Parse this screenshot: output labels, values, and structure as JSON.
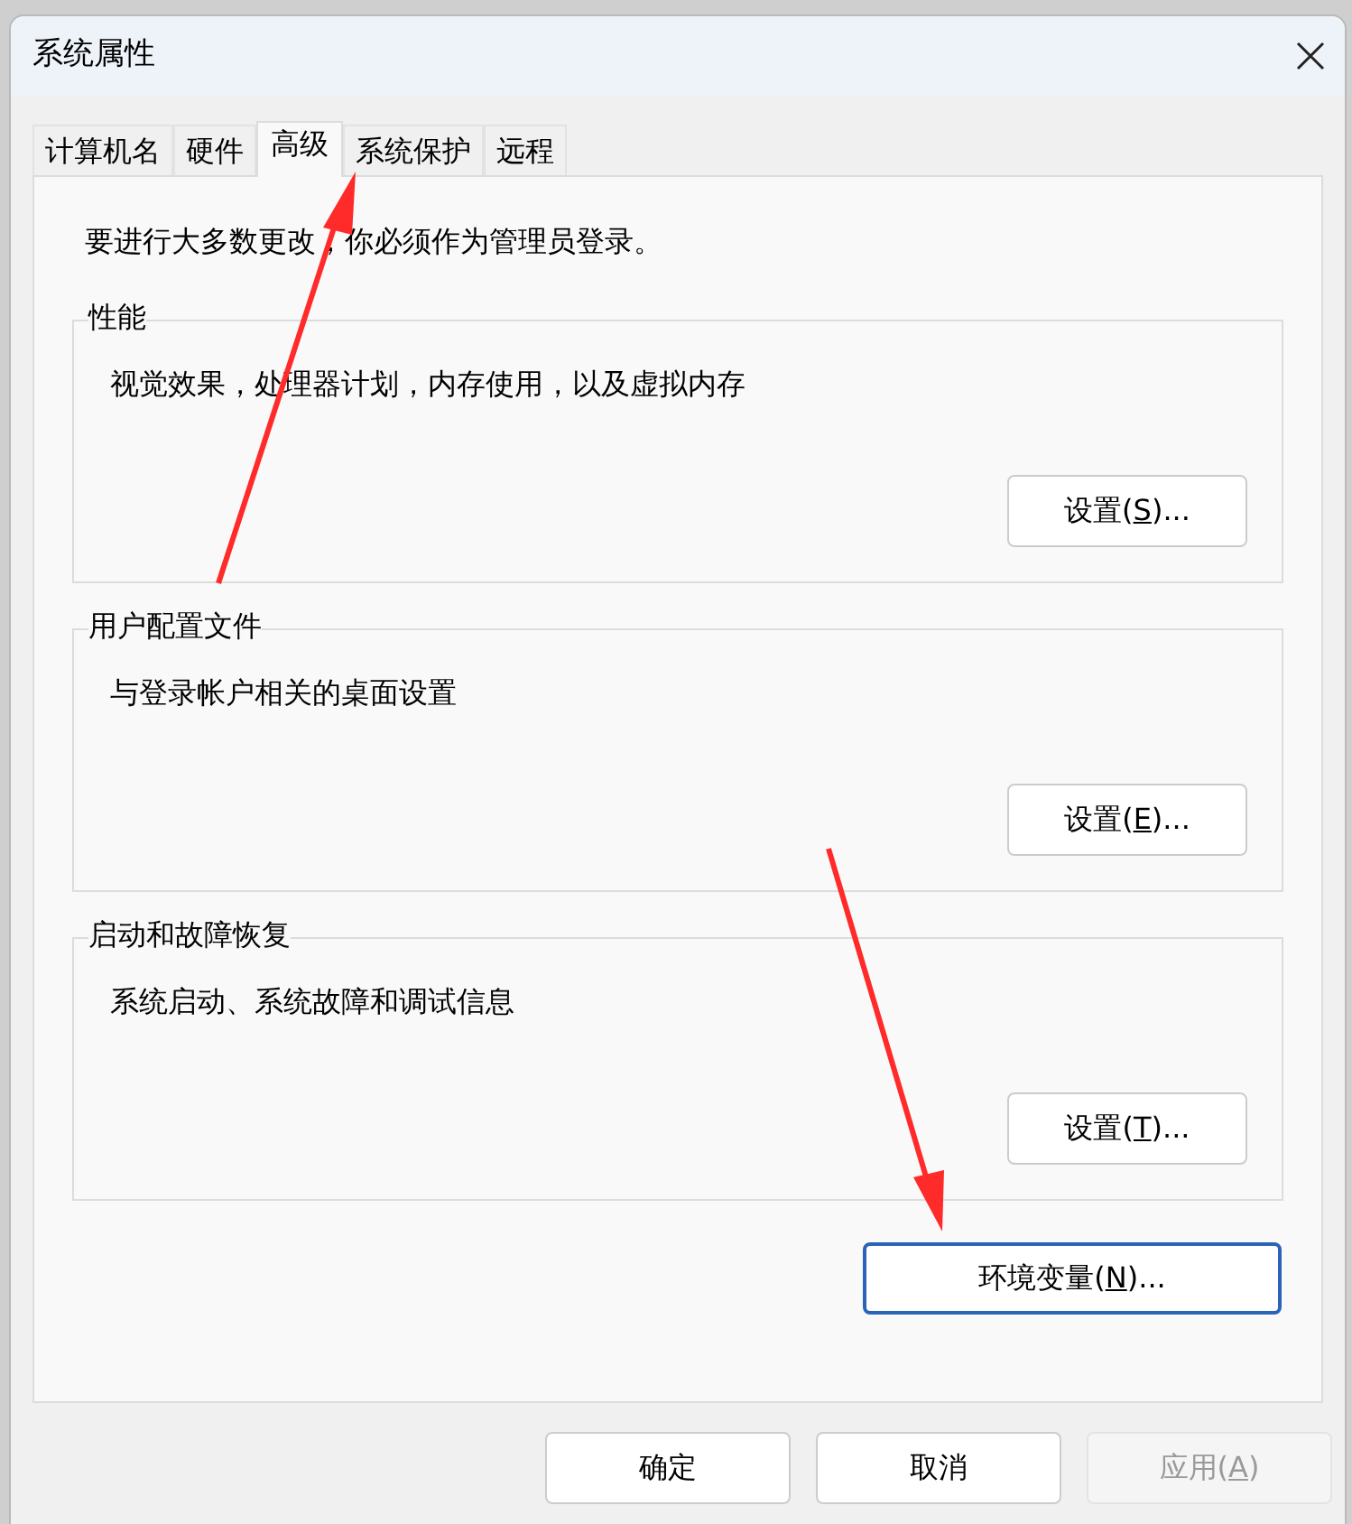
{
  "window": {
    "title": "系统属性"
  },
  "tabs": [
    {
      "label": "计算机名",
      "selected": false
    },
    {
      "label": "硬件",
      "selected": false
    },
    {
      "label": "高级",
      "selected": true
    },
    {
      "label": "系统保护",
      "selected": false
    },
    {
      "label": "远程",
      "selected": false
    }
  ],
  "notice": "要进行大多数更改，你必须作为管理员登录。",
  "groups": [
    {
      "title": "性能",
      "description": "视觉效果，处理器计划，内存使用，以及虚拟内存",
      "button": {
        "before": "设置(",
        "key": "S",
        "after": ")..."
      }
    },
    {
      "title": "用户配置文件",
      "description": "与登录帐户相关的桌面设置",
      "button": {
        "before": "设置(",
        "key": "E",
        "after": ")..."
      }
    },
    {
      "title": "启动和故障恢复",
      "description": "系统启动、系统故障和调试信息",
      "button": {
        "before": "设置(",
        "key": "T",
        "after": ")..."
      }
    }
  ],
  "env_button": {
    "before": "环境变量(",
    "key": "N",
    "after": ")...",
    "focused": true
  },
  "buttons": [
    {
      "before": "确定",
      "disabled": false
    },
    {
      "before": "取消",
      "disabled": false
    },
    {
      "before": "应用(",
      "key": "A",
      "after": ")",
      "disabled": true
    }
  ]
}
